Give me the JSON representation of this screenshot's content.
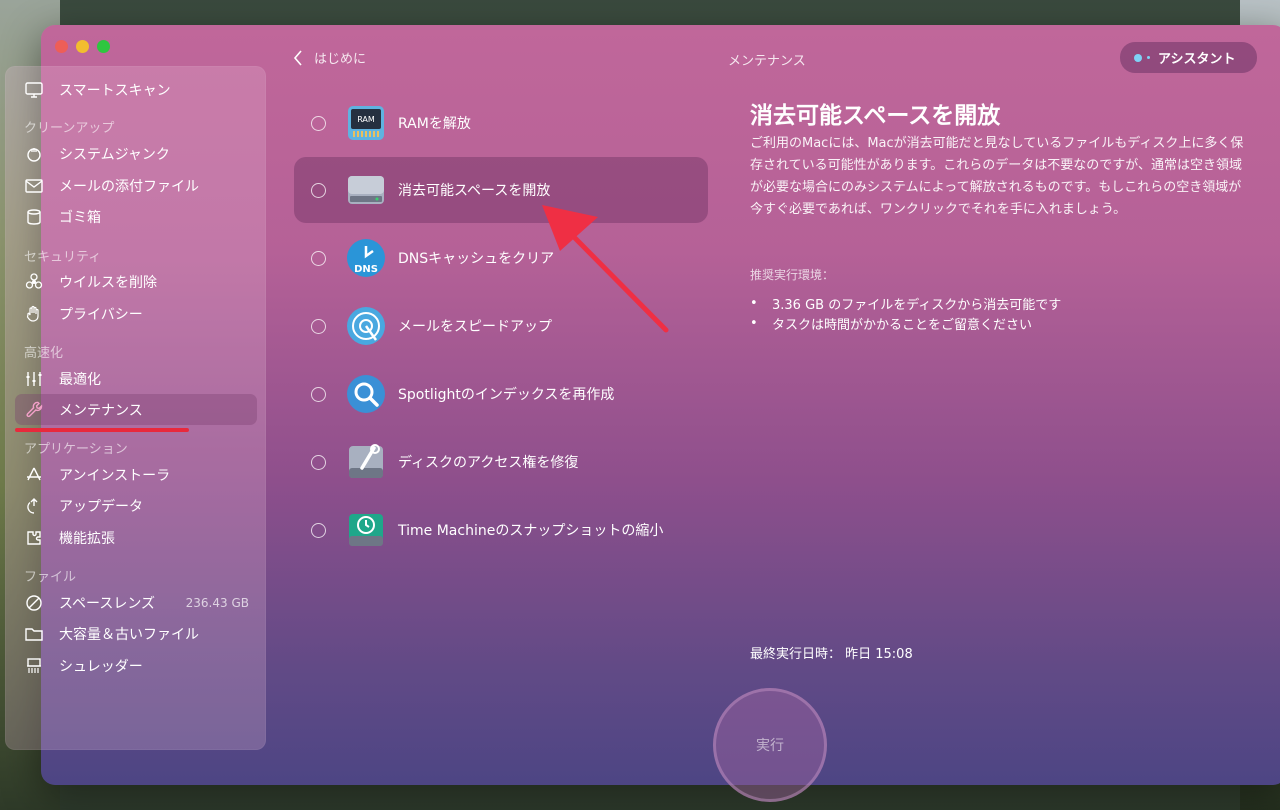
{
  "header": {
    "back_label": "はじめに",
    "title": "メンテナンス",
    "assistant_label": "アシスタント"
  },
  "sidebar": {
    "top_item": "スマートスキャン",
    "sections": [
      {
        "title": "クリーンアップ",
        "items": [
          "システムジャンク",
          "メールの添付ファイル",
          "ゴミ箱"
        ]
      },
      {
        "title": "セキュリティ",
        "items": [
          "ウイルスを削除",
          "プライバシー"
        ]
      },
      {
        "title": "高速化",
        "items": [
          "最適化",
          "メンテナンス"
        ]
      },
      {
        "title": "アプリケーション",
        "items": [
          "アンインストーラ",
          "アップデータ",
          "機能拡張"
        ]
      },
      {
        "title": "ファイル",
        "items": [
          "スペースレンズ",
          "大容量＆古いファイル",
          "シュレッダー"
        ]
      }
    ],
    "space_lens_size": "236.43 GB",
    "active_item": "メンテナンス"
  },
  "tasks": [
    {
      "label": "RAMを解放",
      "icon": "ram-chip-icon"
    },
    {
      "label": "消去可能スペースを開放",
      "icon": "disk-drive-icon",
      "selected": true
    },
    {
      "label": "DNSキャッシュをクリア",
      "icon": "dns-clock-icon"
    },
    {
      "label": "メールをスピードアップ",
      "icon": "mail-speed-icon"
    },
    {
      "label": "Spotlightのインデックスを再作成",
      "icon": "spotlight-search-icon"
    },
    {
      "label": "ディスクのアクセス権を修復",
      "icon": "disk-wrench-icon"
    },
    {
      "label": "Time Machineのスナップショットの縮小",
      "icon": "time-machine-icon"
    }
  ],
  "detail": {
    "title": "消去可能スペースを開放",
    "description": "ご利用のMacには、Macが消去可能だと見なしているファイルもディスク上に多く保存されている可能性があります。これらのデータは不要なのですが、通常は空き領域が必要な場合にのみシステムによって解放されるものです。もしこれらの空き領域が今すぐ必要であれば、ワンクリックでそれを手に入れましょう。",
    "recommended_label": "推奨実行環境：",
    "recommendations": [
      "3.36 GB のファイルをディスクから消去可能です",
      "タスクは時間がかかることをご留意ください"
    ],
    "last_run": "最終実行日時：  昨日 15:08"
  },
  "run_button_label": "実行",
  "colors": {
    "annotation_red": "#e8293c",
    "accent_blue": "#7fd2f6"
  }
}
